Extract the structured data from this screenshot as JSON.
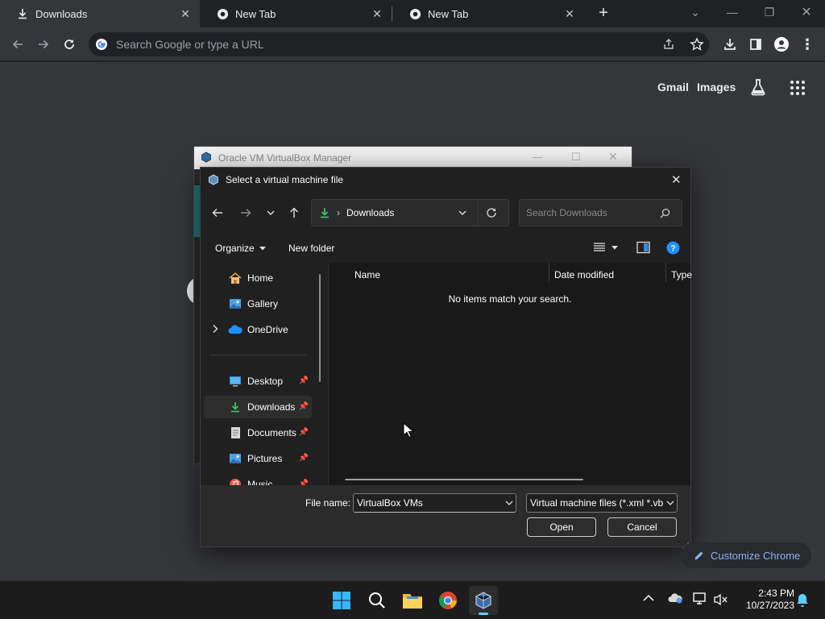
{
  "chrome": {
    "tabs": [
      {
        "label": "Downloads",
        "icon": "download-icon",
        "active": true
      },
      {
        "label": "New Tab",
        "icon": "chrome-icon",
        "active": false
      },
      {
        "label": "New Tab",
        "icon": "chrome-icon",
        "active": false
      }
    ],
    "new_tab_symbol": "+",
    "omnibox_placeholder": "Search Google or type a URL"
  },
  "ntp": {
    "gmail": "Gmail",
    "images": "Images",
    "customize": "Customize Chrome"
  },
  "vbox_manager": {
    "title": "Oracle VM VirtualBox Manager"
  },
  "dialog": {
    "title": "Select a virtual machine file",
    "breadcrumb_separator": "›",
    "location": "Downloads",
    "search_placeholder": "Search Downloads",
    "organize_label": "Organize",
    "new_folder_label": "New folder",
    "nav_items": [
      {
        "label": "Home",
        "icon": "home-icon"
      },
      {
        "label": "Gallery",
        "icon": "gallery-icon"
      },
      {
        "label": "OneDrive",
        "icon": "onedrive-icon"
      },
      {
        "label": "Desktop",
        "icon": "desktop-icon",
        "pinned": true
      },
      {
        "label": "Downloads",
        "icon": "download-icon",
        "pinned": true,
        "selected": true
      },
      {
        "label": "Documents",
        "icon": "documents-icon",
        "pinned": true
      },
      {
        "label": "Pictures",
        "icon": "pictures-icon",
        "pinned": true
      },
      {
        "label": "Music",
        "icon": "music-icon",
        "pinned": true
      }
    ],
    "columns": [
      "Name",
      "Date modified",
      "Type"
    ],
    "empty_message": "No items match your search.",
    "file_name_label": "File name:",
    "file_name_value": "VirtualBox VMs",
    "file_type_value": "Virtual machine files (*.xml *.vb",
    "open_label": "Open",
    "cancel_label": "Cancel"
  },
  "taskbar": {
    "time": "2:43 PM",
    "date": "10/27/2023"
  },
  "colors": {
    "chrome_bg": "#202124",
    "toolbar_bg": "#35363a",
    "dialog_bg": "#202020",
    "accent_blue": "#8ab4f8",
    "download_green": "#3fc86e",
    "help_blue": "#1e90ff"
  }
}
